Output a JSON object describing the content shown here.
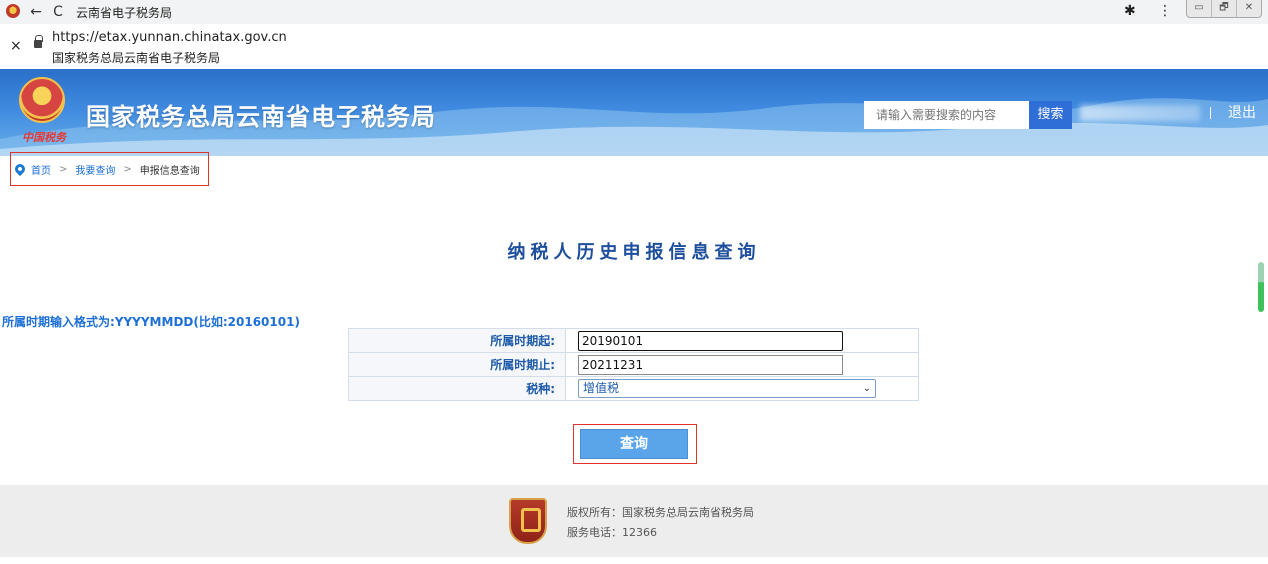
{
  "browser": {
    "window_title": "云南省电子税务局",
    "url": "https://etax.yunnan.chinatax.gov.cn",
    "site_name": "国家税务总局云南省电子税务局",
    "back_icon": "←",
    "reload_icon": "C",
    "extensions_icon": "✱",
    "menu_icon": "⋮",
    "close_icon": "×",
    "window_controls": [
      "▭",
      "🗗",
      "✕"
    ]
  },
  "header": {
    "emblem_text": "中国税务",
    "title": "国家税务总局云南省电子税务局",
    "search_placeholder": "请输入需要搜索的内容",
    "search_label": "搜索",
    "logout_label": "退出"
  },
  "breadcrumb": {
    "home": "首页",
    "sep": ">",
    "level2": "我要查询",
    "current": "申报信息查询"
  },
  "main": {
    "title": "纳税人历史申报信息查询",
    "format_hint": "所属时期输入格式为:YYYYMMDD(比如:20160101)",
    "form": {
      "start_label": "所属时期起:",
      "start_value": "20190101",
      "end_label": "所属时期止:",
      "end_value": "20211231",
      "tax_type_label": "税种:",
      "tax_type_value": "增值税",
      "chevron": "⌄"
    },
    "query_label": "查询"
  },
  "footer": {
    "copyright": "版权所有：国家税务总局云南省税务局",
    "phone": "服务电话：12366"
  },
  "colors": {
    "banner_blue": "#2a6fc8",
    "link_blue": "#1a6fd2",
    "label_blue": "#1d5aa8",
    "button_blue": "#5aa5ea",
    "highlight_red": "#e0332d"
  }
}
